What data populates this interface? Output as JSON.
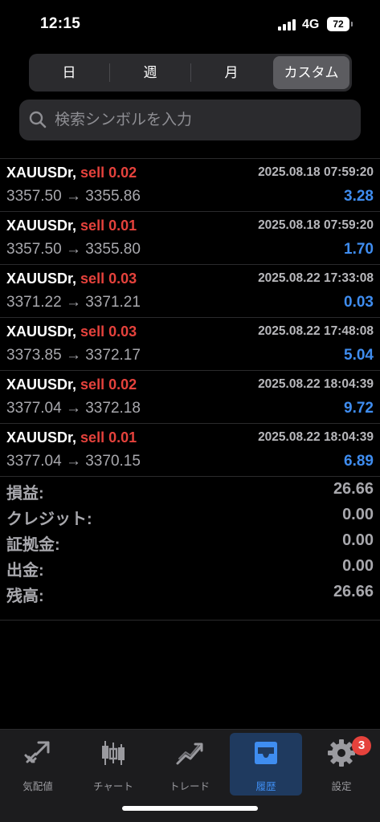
{
  "status_bar": {
    "time": "12:15",
    "network": "4G",
    "battery": "72"
  },
  "period_tabs": [
    {
      "label": "日",
      "active": false
    },
    {
      "label": "週",
      "active": false
    },
    {
      "label": "月",
      "active": false
    },
    {
      "label": "カスタム",
      "active": true
    }
  ],
  "search": {
    "placeholder": "検索シンボルを入力"
  },
  "deals": [
    {
      "symbol": "XAUUSDr,",
      "type": "sell 0.02",
      "time": "2025.08.18 07:59:20",
      "prices": "3357.50 → 3355.86",
      "profit": "3.28"
    },
    {
      "symbol": "XAUUSDr,",
      "type": "sell 0.01",
      "time": "2025.08.18 07:59:20",
      "prices": "3357.50 → 3355.80",
      "profit": "1.70"
    },
    {
      "symbol": "XAUUSDr,",
      "type": "sell 0.03",
      "time": "2025.08.22 17:33:08",
      "prices": "3371.22 → 3371.21",
      "profit": "0.03"
    },
    {
      "symbol": "XAUUSDr,",
      "type": "sell 0.03",
      "time": "2025.08.22 17:48:08",
      "prices": "3373.85 → 3372.17",
      "profit": "5.04"
    },
    {
      "symbol": "XAUUSDr,",
      "type": "sell 0.02",
      "time": "2025.08.22 18:04:39",
      "prices": "3377.04 → 3372.18",
      "profit": "9.72"
    },
    {
      "symbol": "XAUUSDr,",
      "type": "sell 0.01",
      "time": "2025.08.22 18:04:39",
      "prices": "3377.04 → 3370.15",
      "profit": "6.89"
    }
  ],
  "summary": [
    {
      "label": "損益:",
      "value": "26.66"
    },
    {
      "label": "クレジット:",
      "value": "0.00"
    },
    {
      "label": "証拠金:",
      "value": "0.00"
    },
    {
      "label": "出金:",
      "value": "0.00"
    },
    {
      "label": "残高:",
      "value": "26.66"
    }
  ],
  "tabbar": {
    "items": [
      {
        "label": "気配値",
        "icon": "quotes-icon",
        "active": false
      },
      {
        "label": "チャート",
        "icon": "chart-icon",
        "active": false
      },
      {
        "label": "トレード",
        "icon": "trade-icon",
        "active": false
      },
      {
        "label": "履歴",
        "icon": "history-icon",
        "active": true
      },
      {
        "label": "設定",
        "icon": "gear-icon",
        "active": false
      }
    ],
    "settings_badge": "3"
  },
  "colors": {
    "sell": "#e5423c",
    "profit": "#3f8df0",
    "active_tab": "#3f8df0",
    "badge": "#e5423c"
  }
}
